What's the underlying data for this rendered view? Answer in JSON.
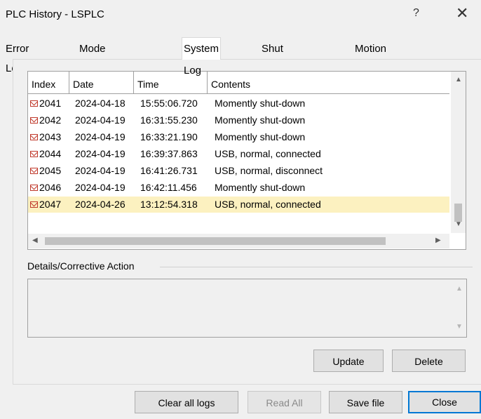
{
  "window": {
    "title": "PLC History - LSPLC",
    "help_label": "?",
    "close_label": "✕"
  },
  "tabs": [
    {
      "label": "Error Log",
      "active": false
    },
    {
      "label": "Mode Change Log",
      "active": false
    },
    {
      "label": "System Log",
      "active": true
    },
    {
      "label": "Shut Down Log",
      "active": false
    },
    {
      "label": "Motion Error History",
      "active": false
    }
  ],
  "table": {
    "columns": [
      "Index",
      "Date",
      "Time",
      "Contents"
    ],
    "rows": [
      {
        "index": "2041",
        "date": "2024-04-18",
        "time": "15:55:06.720",
        "contents": "Momently shut-down",
        "selected": false
      },
      {
        "index": "2042",
        "date": "2024-04-19",
        "time": "16:31:55.230",
        "contents": "Momently shut-down",
        "selected": false
      },
      {
        "index": "2043",
        "date": "2024-04-19",
        "time": "16:33:21.190",
        "contents": "Momently shut-down",
        "selected": false
      },
      {
        "index": "2044",
        "date": "2024-04-19",
        "time": "16:39:37.863",
        "contents": "USB, normal, connected",
        "selected": false
      },
      {
        "index": "2045",
        "date": "2024-04-19",
        "time": "16:41:26.731",
        "contents": "USB, normal, disconnect",
        "selected": false
      },
      {
        "index": "2046",
        "date": "2024-04-19",
        "time": "16:42:11.456",
        "contents": "Momently shut-down",
        "selected": false
      },
      {
        "index": "2047",
        "date": "2024-04-26",
        "time": "13:12:54.318",
        "contents": "USB, normal, connected",
        "selected": true
      }
    ],
    "selected_row_color": "#fcf1c0",
    "row_icon": "log-entry-envelope-icon"
  },
  "details": {
    "label": "Details/Corrective Action",
    "text": ""
  },
  "panel_buttons": {
    "update": "Update",
    "delete": "Delete"
  },
  "footer_buttons": {
    "clear_all_logs": "Clear all logs",
    "read_all": "Read All",
    "save_file": "Save file",
    "close": "Close"
  },
  "colors": {
    "accent": "#0078d4",
    "envelope_icon": "#c0392b"
  }
}
